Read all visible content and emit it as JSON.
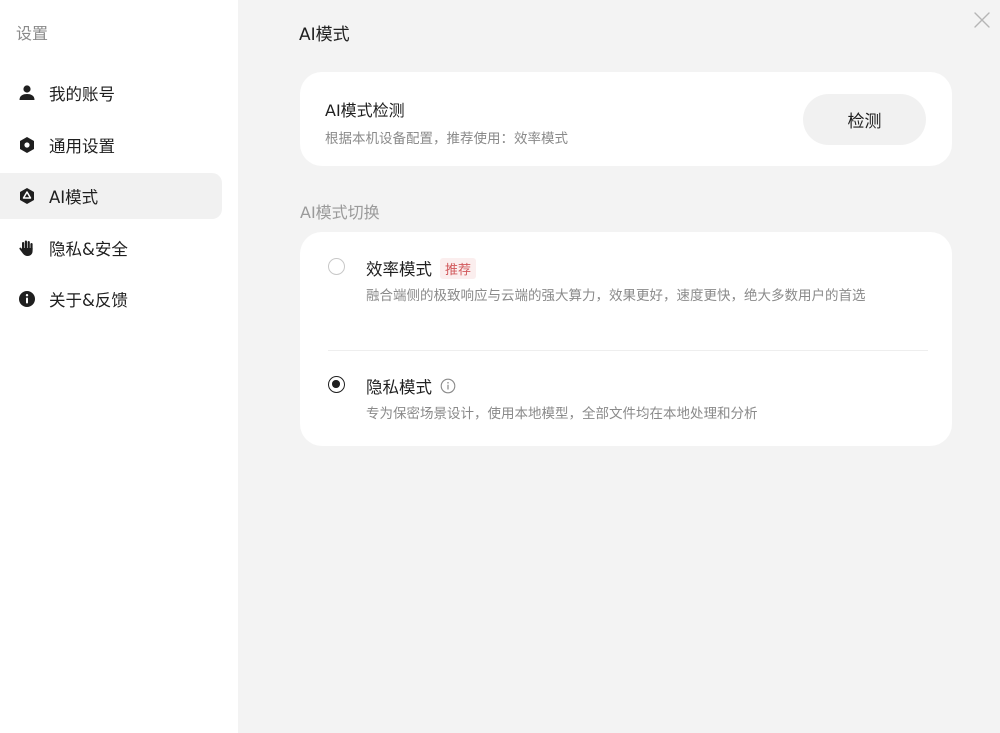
{
  "sidebar": {
    "title": "设置",
    "items": [
      {
        "label": "我的账号",
        "icon": "person-icon",
        "active": false
      },
      {
        "label": "通用设置",
        "icon": "settings-hexagon-icon",
        "active": false
      },
      {
        "label": "AI模式",
        "icon": "ai-hexagon-icon",
        "active": true
      },
      {
        "label": "隐私&安全",
        "icon": "hand-icon",
        "active": false
      },
      {
        "label": "关于&反馈",
        "icon": "info-circle-icon",
        "active": false
      }
    ]
  },
  "main": {
    "title": "AI模式",
    "close_icon": "close-icon",
    "detect": {
      "title": "AI模式检测",
      "description": "根据本机设备配置，推荐使用：效率模式",
      "button_label": "检测"
    },
    "switch_section": {
      "label": "AI模式切换",
      "options": [
        {
          "title": "效率模式",
          "badge": "推荐",
          "description": "融合端侧的极致响应与云端的强大算力，效果更好，速度更快，绝大多数用户的首选",
          "selected": false
        },
        {
          "title": "隐私模式",
          "info_icon": "info-icon",
          "description": "专为保密场景设计，使用本地模型，全部文件均在本地处理和分析",
          "selected": true
        }
      ]
    }
  },
  "colors": {
    "sidebar_bg": "#ffffff",
    "content_bg": "#f3f3f3",
    "active_item_bg": "#f1f1f1",
    "badge_text": "#d1585b",
    "badge_bg": "#fbeeee"
  }
}
